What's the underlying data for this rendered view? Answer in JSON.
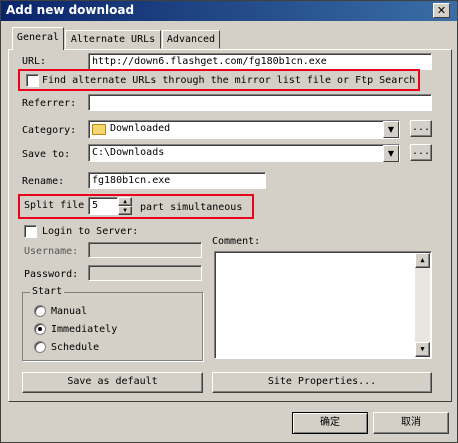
{
  "window": {
    "title": "Add new download",
    "close_glyph": "✕"
  },
  "tabs": [
    {
      "label": "General"
    },
    {
      "label": "Alternate URLs"
    },
    {
      "label": "Advanced"
    }
  ],
  "url": {
    "label": "URL:",
    "value": "http://down6.flashget.com/fg180b1cn.exe"
  },
  "mirror": {
    "label": "Find alternate URLs through the mirror list file or Ftp Search",
    "checked": false
  },
  "referrer": {
    "label": "Referrer:",
    "value": ""
  },
  "category": {
    "label": "Category:",
    "value": "Downloaded",
    "icon": "folder-icon",
    "more": "..."
  },
  "save_to": {
    "label": "Save to:",
    "value": "C:\\Downloads",
    "more": "..."
  },
  "rename": {
    "label": "Rename:",
    "value": "fg180b1cn.exe"
  },
  "split": {
    "label": "Split file",
    "value": "5",
    "suffix": "part simultaneous"
  },
  "login": {
    "label": "Login to Server:",
    "checked": false,
    "username_label": "Username:",
    "password_label": "Password:"
  },
  "comment": {
    "label": "Comment:"
  },
  "start": {
    "legend": "Start",
    "options": [
      "Manual",
      "Immediately",
      "Schedule"
    ],
    "selected": "Immediately"
  },
  "buttons": {
    "save_default": "Save as default",
    "site_properties": "Site Properties...",
    "ok": "确定",
    "cancel": "取消"
  },
  "highlight_color": "#e8001c"
}
